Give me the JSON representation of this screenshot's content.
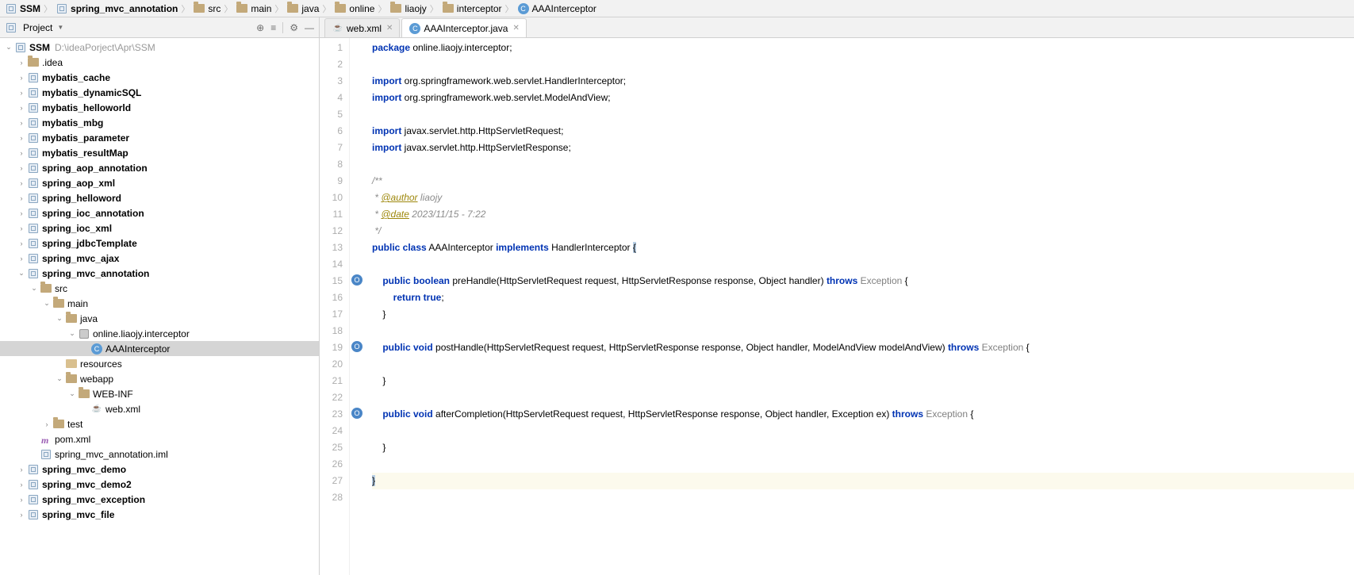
{
  "breadcrumb": [
    {
      "label": "SSM",
      "bold": true,
      "icon": "module"
    },
    {
      "label": "spring_mvc_annotation",
      "bold": true,
      "icon": "module"
    },
    {
      "label": "src",
      "bold": false,
      "icon": "folder"
    },
    {
      "label": "main",
      "bold": false,
      "icon": "folder"
    },
    {
      "label": "java",
      "bold": false,
      "icon": "folder"
    },
    {
      "label": "online",
      "bold": false,
      "icon": "folder"
    },
    {
      "label": "liaojy",
      "bold": false,
      "icon": "folder"
    },
    {
      "label": "interceptor",
      "bold": false,
      "icon": "folder"
    },
    {
      "label": "AAAInterceptor",
      "bold": false,
      "icon": "java"
    }
  ],
  "panel": {
    "title": "Project"
  },
  "tree": [
    {
      "indent": 0,
      "tw": "v",
      "icon": "module",
      "label": "SSM",
      "bold": true,
      "path": "D:\\ideaPorject\\Apr\\SSM"
    },
    {
      "indent": 1,
      "tw": ">",
      "icon": "folder",
      "label": ".idea",
      "bold": false
    },
    {
      "indent": 1,
      "tw": ">",
      "icon": "module",
      "label": "mybatis_cache",
      "bold": true
    },
    {
      "indent": 1,
      "tw": ">",
      "icon": "module",
      "label": "mybatis_dynamicSQL",
      "bold": true
    },
    {
      "indent": 1,
      "tw": ">",
      "icon": "module",
      "label": "mybatis_helloworld",
      "bold": true
    },
    {
      "indent": 1,
      "tw": ">",
      "icon": "module",
      "label": "mybatis_mbg",
      "bold": true
    },
    {
      "indent": 1,
      "tw": ">",
      "icon": "module",
      "label": "mybatis_parameter",
      "bold": true
    },
    {
      "indent": 1,
      "tw": ">",
      "icon": "module",
      "label": "mybatis_resultMap",
      "bold": true
    },
    {
      "indent": 1,
      "tw": ">",
      "icon": "module",
      "label": "spring_aop_annotation",
      "bold": true
    },
    {
      "indent": 1,
      "tw": ">",
      "icon": "module",
      "label": "spring_aop_xml",
      "bold": true
    },
    {
      "indent": 1,
      "tw": ">",
      "icon": "module",
      "label": "spring_helloword",
      "bold": true
    },
    {
      "indent": 1,
      "tw": ">",
      "icon": "module",
      "label": "spring_ioc_annotation",
      "bold": true
    },
    {
      "indent": 1,
      "tw": ">",
      "icon": "module",
      "label": "spring_ioc_xml",
      "bold": true
    },
    {
      "indent": 1,
      "tw": ">",
      "icon": "module",
      "label": "spring_jdbcTemplate",
      "bold": true
    },
    {
      "indent": 1,
      "tw": ">",
      "icon": "module",
      "label": "spring_mvc_ajax",
      "bold": true
    },
    {
      "indent": 1,
      "tw": "v",
      "icon": "module",
      "label": "spring_mvc_annotation",
      "bold": true
    },
    {
      "indent": 2,
      "tw": "v",
      "icon": "folder",
      "label": "src",
      "bold": false
    },
    {
      "indent": 3,
      "tw": "v",
      "icon": "folder",
      "label": "main",
      "bold": false
    },
    {
      "indent": 4,
      "tw": "v",
      "icon": "folder",
      "label": "java",
      "bold": false
    },
    {
      "indent": 5,
      "tw": "v",
      "icon": "pkg",
      "label": "online.liaojy.interceptor",
      "bold": false
    },
    {
      "indent": 6,
      "tw": "",
      "icon": "java",
      "label": "AAAInterceptor",
      "bold": false,
      "selected": true
    },
    {
      "indent": 4,
      "tw": "",
      "icon": "res",
      "label": "resources",
      "bold": false
    },
    {
      "indent": 4,
      "tw": "v",
      "icon": "folder",
      "label": "webapp",
      "bold": false
    },
    {
      "indent": 5,
      "tw": "v",
      "icon": "folder",
      "label": "WEB-INF",
      "bold": false
    },
    {
      "indent": 6,
      "tw": "",
      "icon": "xml",
      "label": "web.xml",
      "bold": false
    },
    {
      "indent": 3,
      "tw": ">",
      "icon": "folder",
      "label": "test",
      "bold": false
    },
    {
      "indent": 2,
      "tw": "",
      "icon": "m",
      "label": "pom.xml",
      "bold": false
    },
    {
      "indent": 2,
      "tw": "",
      "icon": "module",
      "label": "spring_mvc_annotation.iml",
      "bold": false
    },
    {
      "indent": 1,
      "tw": ">",
      "icon": "module",
      "label": "spring_mvc_demo",
      "bold": true
    },
    {
      "indent": 1,
      "tw": ">",
      "icon": "module",
      "label": "spring_mvc_demo2",
      "bold": true
    },
    {
      "indent": 1,
      "tw": ">",
      "icon": "module",
      "label": "spring_mvc_exception",
      "bold": true
    },
    {
      "indent": 1,
      "tw": ">",
      "icon": "module",
      "label": "spring_mvc_file",
      "bold": true
    }
  ],
  "tabs": [
    {
      "label": "web.xml",
      "icon": "xml",
      "active": false
    },
    {
      "label": "AAAInterceptor.java",
      "icon": "java",
      "active": true
    }
  ],
  "code": {
    "line_count": 28,
    "override_marks": [
      15,
      19,
      23
    ],
    "highlight_line": 27,
    "lines": [
      {
        "n": 1,
        "t": [
          {
            "c": "kw",
            "s": "package"
          },
          {
            "c": "pkg",
            "s": " online.liaojy.interceptor;"
          }
        ]
      },
      {
        "n": 2,
        "t": []
      },
      {
        "n": 3,
        "t": [
          {
            "c": "kw",
            "s": "import"
          },
          {
            "c": "pkg",
            "s": " org.springframework.web.servlet.HandlerInterceptor;"
          }
        ]
      },
      {
        "n": 4,
        "t": [
          {
            "c": "kw",
            "s": "import"
          },
          {
            "c": "pkg",
            "s": " org.springframework.web.servlet.ModelAndView;"
          }
        ]
      },
      {
        "n": 5,
        "t": []
      },
      {
        "n": 6,
        "t": [
          {
            "c": "kw",
            "s": "import"
          },
          {
            "c": "pkg",
            "s": " javax.servlet.http.HttpServletRequest;"
          }
        ]
      },
      {
        "n": 7,
        "t": [
          {
            "c": "kw",
            "s": "import"
          },
          {
            "c": "pkg",
            "s": " javax.servlet.http.HttpServletResponse;"
          }
        ]
      },
      {
        "n": 8,
        "t": []
      },
      {
        "n": 9,
        "t": [
          {
            "c": "cmt",
            "s": "/**"
          }
        ]
      },
      {
        "n": 10,
        "t": [
          {
            "c": "cmt",
            "s": " * "
          },
          {
            "c": "ann",
            "s": "@author"
          },
          {
            "c": "cmt",
            "s": " liaojy"
          }
        ]
      },
      {
        "n": 11,
        "t": [
          {
            "c": "cmt",
            "s": " * "
          },
          {
            "c": "ann",
            "s": "@date"
          },
          {
            "c": "cmt",
            "s": " 2023/11/15 - 7:22"
          }
        ]
      },
      {
        "n": 12,
        "t": [
          {
            "c": "cmt",
            "s": " */"
          }
        ]
      },
      {
        "n": 13,
        "t": [
          {
            "c": "kw",
            "s": "public class"
          },
          {
            "c": "cls",
            "s": " AAAInterceptor "
          },
          {
            "c": "kw",
            "s": "implements"
          },
          {
            "c": "cls",
            "s": " HandlerInterceptor "
          },
          {
            "c": "bracehl",
            "s": "{"
          }
        ]
      },
      {
        "n": 14,
        "t": []
      },
      {
        "n": 15,
        "t": [
          {
            "c": "op",
            "s": "    "
          },
          {
            "c": "kw",
            "s": "public boolean"
          },
          {
            "c": "cls",
            "s": " preHandle(HttpServletRequest request, HttpServletResponse response, Object handler) "
          },
          {
            "c": "kw",
            "s": "throws"
          },
          {
            "c": "excgrey",
            "s": " Exception"
          },
          {
            "c": "cls",
            "s": " {"
          }
        ]
      },
      {
        "n": 16,
        "t": [
          {
            "c": "op",
            "s": "        "
          },
          {
            "c": "kw",
            "s": "return true"
          },
          {
            "c": "cls",
            "s": ";"
          }
        ]
      },
      {
        "n": 17,
        "t": [
          {
            "c": "cls",
            "s": "    }"
          }
        ]
      },
      {
        "n": 18,
        "t": []
      },
      {
        "n": 19,
        "t": [
          {
            "c": "op",
            "s": "    "
          },
          {
            "c": "kw",
            "s": "public void"
          },
          {
            "c": "cls",
            "s": " postHandle(HttpServletRequest request, HttpServletResponse response, Object handler, ModelAndView modelAndView) "
          },
          {
            "c": "kw",
            "s": "throws"
          },
          {
            "c": "excgrey",
            "s": " Exception"
          },
          {
            "c": "cls",
            "s": " {"
          }
        ]
      },
      {
        "n": 20,
        "t": []
      },
      {
        "n": 21,
        "t": [
          {
            "c": "cls",
            "s": "    }"
          }
        ]
      },
      {
        "n": 22,
        "t": []
      },
      {
        "n": 23,
        "t": [
          {
            "c": "op",
            "s": "    "
          },
          {
            "c": "kw",
            "s": "public void"
          },
          {
            "c": "cls",
            "s": " afterCompletion(HttpServletRequest request, HttpServletResponse response, Object handler, Exception ex) "
          },
          {
            "c": "kw",
            "s": "throws"
          },
          {
            "c": "excgrey",
            "s": " Exception"
          },
          {
            "c": "cls",
            "s": " {"
          }
        ]
      },
      {
        "n": 24,
        "t": []
      },
      {
        "n": 25,
        "t": [
          {
            "c": "cls",
            "s": "    }"
          }
        ]
      },
      {
        "n": 26,
        "t": []
      },
      {
        "n": 27,
        "t": [
          {
            "c": "bracehl",
            "s": "}"
          }
        ]
      },
      {
        "n": 28,
        "t": []
      }
    ]
  }
}
